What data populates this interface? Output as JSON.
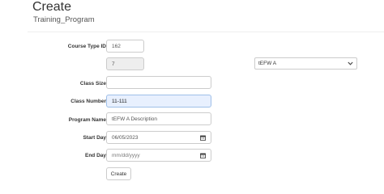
{
  "header": {
    "title": "Create",
    "subtitle": "Training_Program"
  },
  "form": {
    "course_type_id": {
      "label": "Course Type ID",
      "value": "162",
      "code_value": "7",
      "select_value": "tEFW A"
    },
    "class_size": {
      "label": "Class Size",
      "value": ""
    },
    "class_number": {
      "label": "Class Number",
      "value": "11-111"
    },
    "program_name": {
      "label": "Program Name",
      "value": "tEFW A Description"
    },
    "start_day": {
      "label": "Start Day",
      "value": "06/05/2023"
    },
    "end_day": {
      "label": "End Day",
      "placeholder": "mm/dd/yyyy"
    },
    "submit_label": "Create"
  },
  "icons": {
    "calendar": "calendar-icon",
    "dropdown": "chevron-down-icon"
  },
  "colors": {
    "focused_field_bg": "#e8f0fe",
    "readonly_field_bg": "#eeeeee",
    "border": "#cccccc"
  }
}
